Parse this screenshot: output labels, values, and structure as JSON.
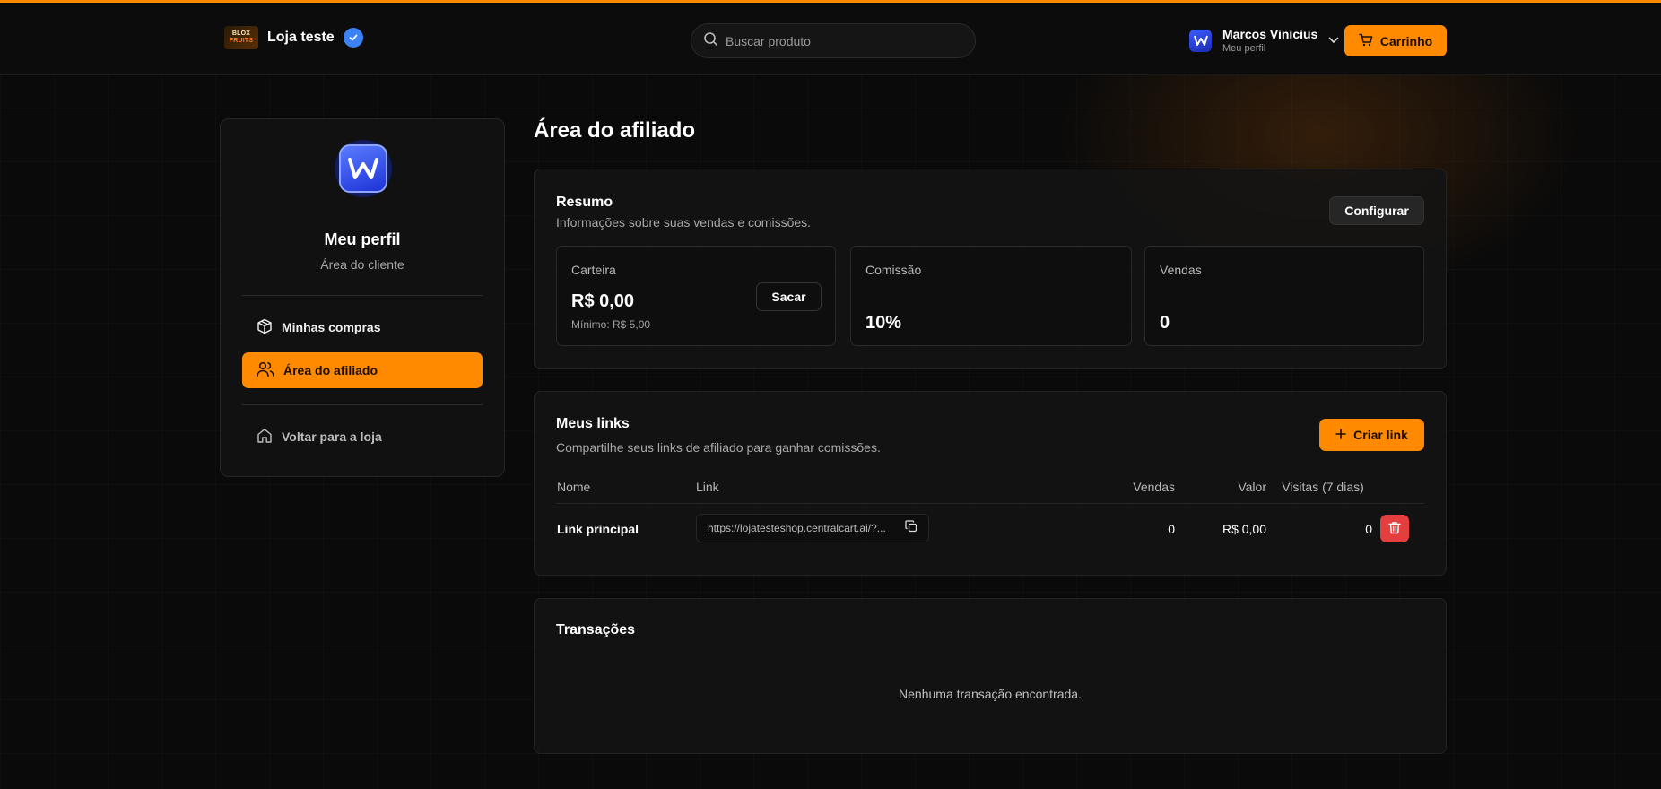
{
  "header": {
    "brand_logo_line1": "BLOX",
    "brand_logo_line2": "FRUITS",
    "store_name": "Loja teste",
    "search_placeholder": "Buscar produto",
    "user_name": "Marcos Vinicius",
    "user_sub": "Meu perfil",
    "cart_label": "Carrinho",
    "accent": "#ff8a00"
  },
  "sidebar": {
    "title": "Meu perfil",
    "subtitle": "Área do cliente",
    "items": [
      {
        "label": "Minhas compras",
        "icon": "box-icon",
        "active": false
      },
      {
        "label": "Área do afiliado",
        "icon": "users-icon",
        "active": true
      },
      {
        "label": "Voltar para a loja",
        "icon": "home-icon",
        "active": false
      }
    ]
  },
  "main": {
    "title": "Área do afiliado",
    "summary": {
      "title": "Resumo",
      "subtitle": "Informações sobre suas vendas e comissões.",
      "configure_label": "Configurar",
      "wallet": {
        "label": "Carteira",
        "value": "R$ 0,00",
        "hint": "Mínimo: R$ 5,00",
        "withdraw_label": "Sacar"
      },
      "commission": {
        "label": "Comissão",
        "value": "10%"
      },
      "sales": {
        "label": "Vendas",
        "value": "0"
      }
    },
    "links": {
      "title": "Meus links",
      "subtitle": "Compartilhe seus links de afiliado para ganhar comissões.",
      "create_label": "Criar link",
      "columns": [
        "Nome",
        "Link",
        "Vendas",
        "Valor",
        "Visitas (7 dias)"
      ],
      "rows": [
        {
          "name": "Link principal",
          "link": "https://lojatesteshop.centralcart.ai/?...",
          "sales": "0",
          "value": "R$ 0,00",
          "visits": "0"
        }
      ]
    },
    "transactions": {
      "title": "Transações",
      "empty": "Nenhuma transação encontrada."
    }
  }
}
